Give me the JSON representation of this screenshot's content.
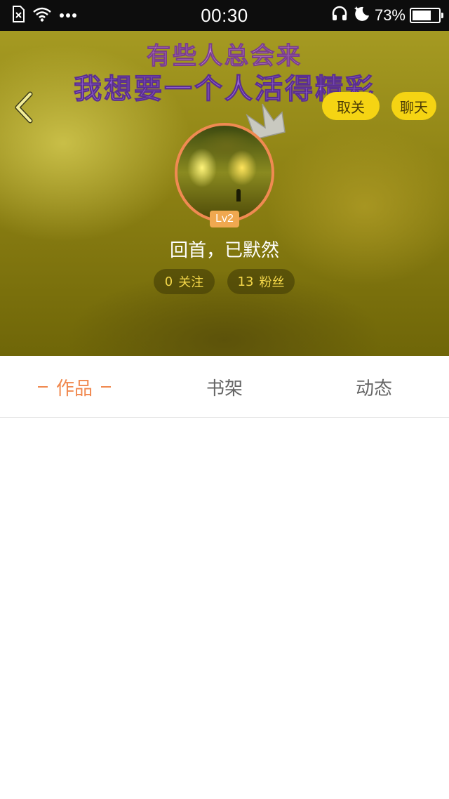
{
  "status_bar": {
    "time": "00:30",
    "battery_percent": "73%",
    "battery_level": 0.73,
    "icons": [
      "sim-error-icon",
      "wifi-icon",
      "more-dots-icon",
      "headphones-icon",
      "do-not-disturb-moon-icon",
      "battery-icon"
    ]
  },
  "header": {
    "banner_line1": "有些人总会来",
    "banner_line2": "我想要一个人活得精彩",
    "unfollow_label": "取关",
    "chat_label": "聊天",
    "level": "Lv2",
    "username": "回首，已默然",
    "following": {
      "count": "0",
      "label": "关注"
    },
    "fans": {
      "count": "13",
      "label": "粉丝"
    }
  },
  "tabs": [
    {
      "label": "作品",
      "active": true
    },
    {
      "label": "书架",
      "active": false
    },
    {
      "label": "动态",
      "active": false
    }
  ],
  "colors": {
    "accent": "#f0884e",
    "button_yellow": "#f5d413",
    "header_olive": "#8e8214"
  }
}
